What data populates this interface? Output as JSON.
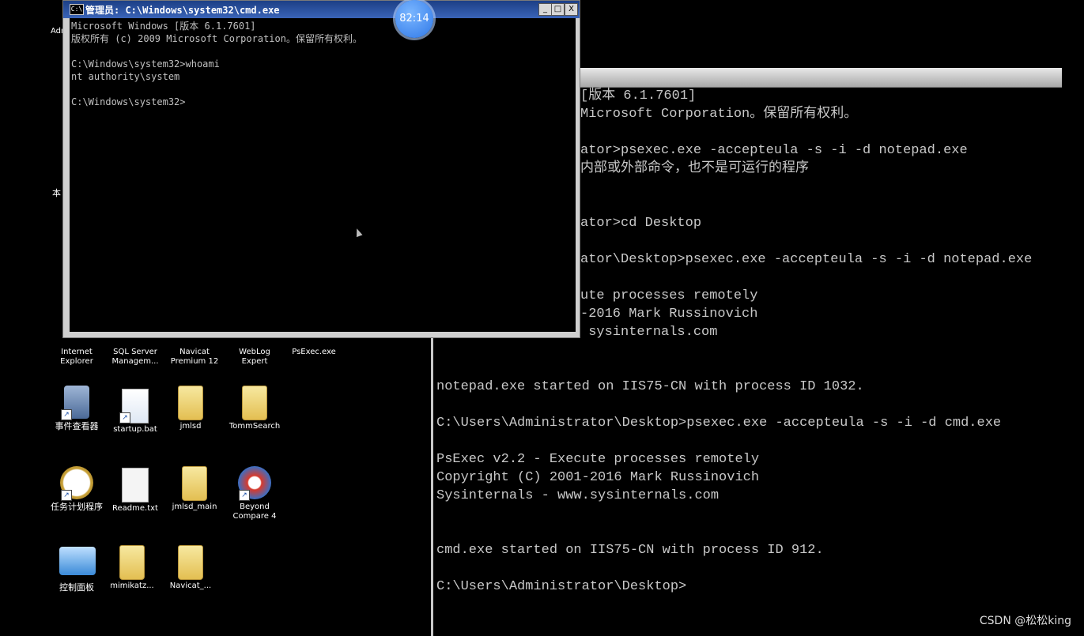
{
  "foreground_window": {
    "title": "管理员: C:\\Windows\\system32\\cmd.exe",
    "buttons": {
      "minimize": "_",
      "maximize": "□",
      "close": "X"
    },
    "lines": [
      "Microsoft Windows [版本 6.1.7601]",
      "版权所有 (c) 2009 Microsoft Corporation。保留所有权利。",
      "",
      "C:\\Windows\\system32>whoami",
      "nt authority\\system",
      "",
      "C:\\Windows\\system32>"
    ]
  },
  "recording_timer": "82:14",
  "background_window": {
    "lines": [
      "[版本 6.1.7601]",
      "Microsoft Corporation。保留所有权利。",
      "",
      "ator>psexec.exe -accepteula -s -i -d notepad.exe",
      "内部或外部命令，也不是可运行的程序",
      "",
      "",
      "ator>cd Desktop",
      "",
      "ator\\Desktop>psexec.exe -accepteula -s -i -d notepad.exe",
      "",
      "ute processes remotely",
      "-2016 Mark Russinovich",
      " sysinternals.com",
      "",
      "",
      "notepad.exe started on IIS75-CN with process ID 1032.",
      "",
      "C:\\Users\\Administrator\\Desktop>psexec.exe -accepteula -s -i -d cmd.exe",
      "",
      "PsExec v2.2 - Execute processes remotely",
      "Copyright (C) 2001-2016 Mark Russinovich",
      "Sysinternals - www.sysinternals.com",
      "",
      "",
      "cmd.exe started on IIS75-CN with process ID 912.",
      "",
      "C:\\Users\\Administrator\\Desktop>"
    ]
  },
  "desktop_icons": {
    "row1": [
      "Internet Explorer",
      "SQL Server Managem...",
      "Navicat Premium 12",
      "WebLog Expert",
      "PsExec.exe"
    ],
    "row2": [
      "事件查看器",
      "startup.bat",
      "jmlsd",
      "TommSearch"
    ],
    "row3": [
      "任务计划程序",
      "Readme.txt",
      "jmlsd_main",
      "Beyond Compare 4"
    ],
    "row4": [
      "控制面板",
      "mimikatz...",
      "Navicat_..."
    ],
    "partial_left": [
      "Adm",
      "本"
    ]
  },
  "watermark": "CSDN @松松king"
}
